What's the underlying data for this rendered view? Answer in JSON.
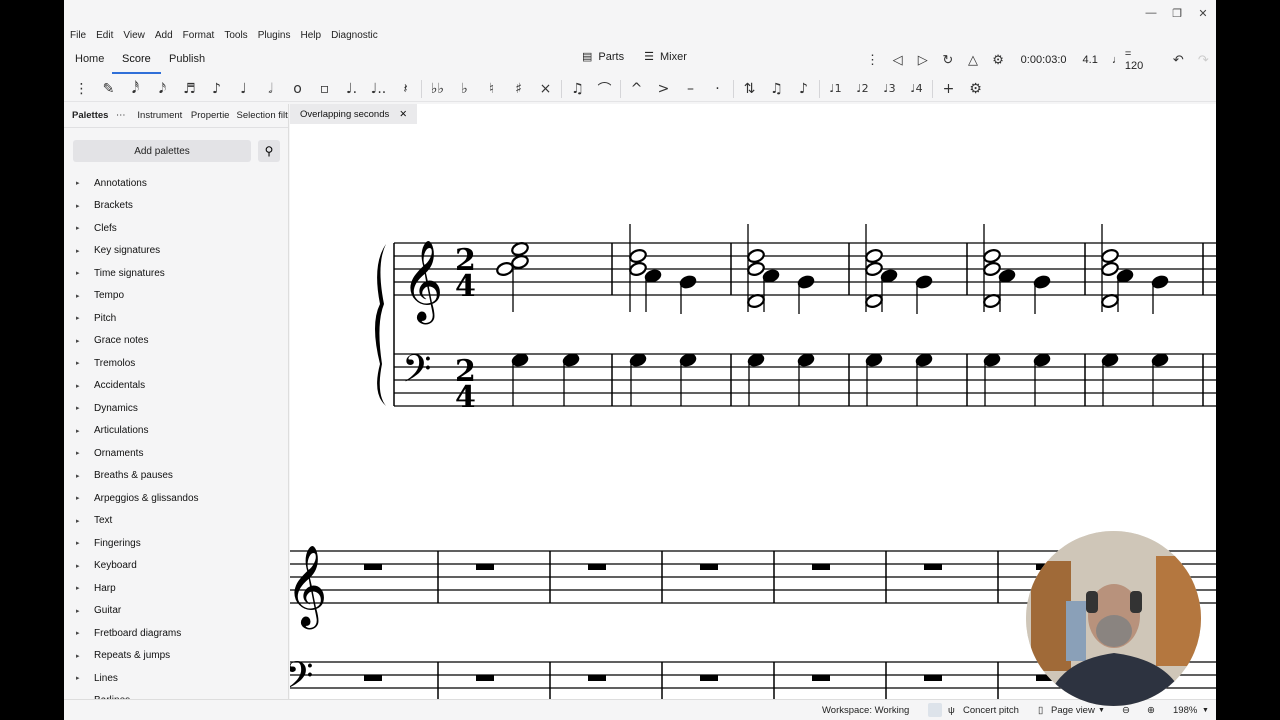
{
  "menu": [
    "File",
    "Edit",
    "View",
    "Add",
    "Format",
    "Tools",
    "Plugins",
    "Help",
    "Diagnostic"
  ],
  "window_controls": [
    "minimize-icon",
    "restore-icon",
    "close-icon"
  ],
  "topbar": {
    "tabs": [
      "Home",
      "Score",
      "Publish"
    ],
    "active_tab": "Score",
    "parts_label": "Parts",
    "mixer_label": "Mixer",
    "time": "0:00:03:0",
    "position": "4.1",
    "tempo_equals": "= 120"
  },
  "toolbar_icons": [
    "grip-icon",
    "pencil-icon",
    "64th-note-icon",
    "32nd-note-icon",
    "16th-note-icon",
    "eighth-note-icon",
    "quarter-note-icon",
    "half-note-icon",
    "whole-note-icon",
    "breve-icon",
    "dot-icon",
    "double-dot-icon",
    "rest-icon",
    "double-flat-icon",
    "flat-icon",
    "natural-icon",
    "sharp-icon",
    "double-sharp-icon",
    "tie-icon",
    "slur-icon",
    "accent-icon",
    "marcato-icon",
    "tenuto-icon",
    "staccato-icon",
    "flip-icon",
    "tuplet-icon",
    "beam-icon",
    "voice1-icon",
    "voice2-icon",
    "voice3-icon",
    "voice4-icon",
    "add-icon",
    "settings-icon"
  ],
  "panel": {
    "tabs": [
      "Palettes",
      "Instrument",
      "Propertie",
      "Selection filte"
    ],
    "add_palettes": "Add palettes",
    "items": [
      "Annotations",
      "Brackets",
      "Clefs",
      "Key signatures",
      "Time signatures",
      "Tempo",
      "Pitch",
      "Grace notes",
      "Tremolos",
      "Accidentals",
      "Dynamics",
      "Articulations",
      "Ornaments",
      "Breaths & pauses",
      "Arpeggios & glissandos",
      "Text",
      "Fingerings",
      "Keyboard",
      "Harp",
      "Guitar",
      "Fretboard diagrams",
      "Repeats & jumps",
      "Lines",
      "Barlines"
    ]
  },
  "document_tab": "Overlapping seconds",
  "score": {
    "time_signature_top": "2",
    "time_signature_bottom": "4"
  },
  "status": {
    "workspace": "Workspace: Working",
    "concert_pitch": "Concert pitch",
    "page_view": "Page view",
    "zoom": "198%"
  }
}
